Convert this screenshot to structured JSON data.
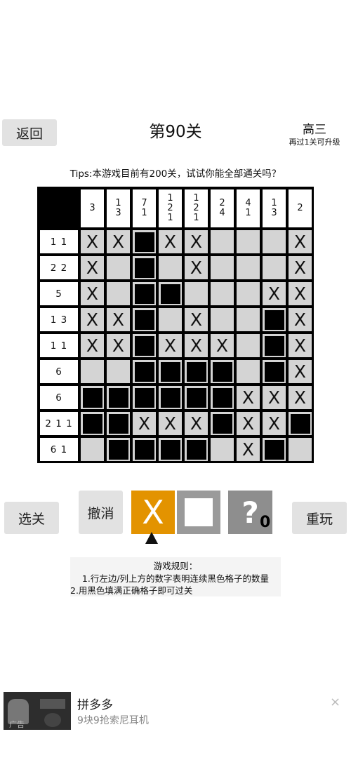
{
  "header": {
    "back_label": "返回",
    "title": "第90关",
    "rank": "高三",
    "rank_sub": "再过1关可升级"
  },
  "tips": "Tips:本游戏目前有200关，试试你能全部通关吗？",
  "puzzle": {
    "col_clues": [
      [
        "3"
      ],
      [
        "1",
        "3"
      ],
      [
        "7",
        "1"
      ],
      [
        "1",
        "2",
        "1"
      ],
      [
        "1",
        "2",
        "1"
      ],
      [
        "2",
        "4"
      ],
      [
        "4",
        "1"
      ],
      [
        "1",
        "3"
      ],
      [
        "2"
      ]
    ],
    "row_clues": [
      "1 1",
      "2 2",
      "5",
      "1 3",
      "1 1",
      "6",
      "6",
      "2 1 1",
      "6 1"
    ],
    "mark_x": "X",
    "grid": [
      "XX#XX...X",
      "X.#.X...X",
      "X.##...XX",
      "XX#.X..#X",
      "XX#XXX.#X",
      "..####.#X",
      "######XXX",
      "##XXX#XX#",
      ".####.X#"
    ]
  },
  "controls": {
    "select_label": "选关",
    "undo_label": "撤消",
    "x_tool_label": "X",
    "hint_symbol": "?",
    "hint_count": "0",
    "restart_label": "重玩",
    "selected_tool": "X"
  },
  "rules": {
    "title": "游戏规则：",
    "line1": "1.行左边/列上方的数字表明连续黑色格子的数量",
    "line2": "2.用黑色填满正确格子即可过关"
  },
  "ad": {
    "title": "拼多多",
    "subtitle": "9块9抢索尼耳机",
    "label": "广告",
    "close_symbol": "×"
  }
}
